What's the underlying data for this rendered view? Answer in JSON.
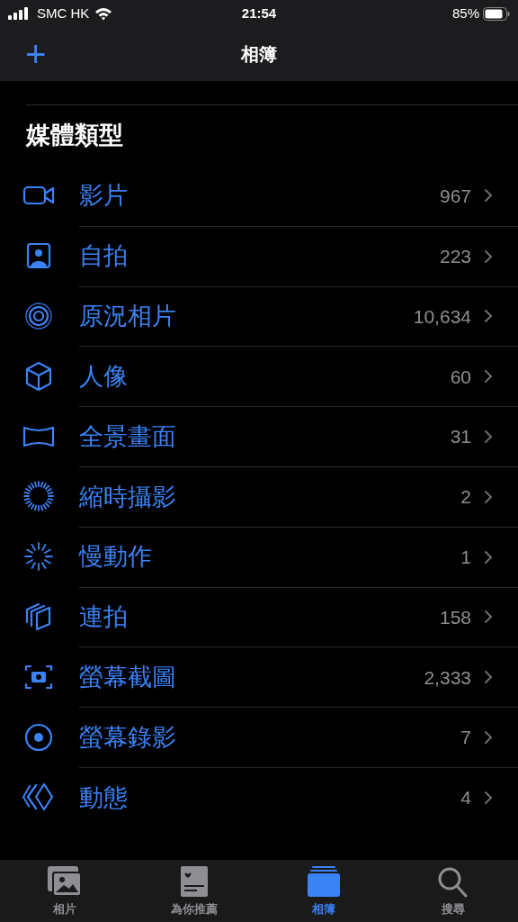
{
  "status_bar": {
    "carrier": "SMC HK",
    "time": "21:54",
    "battery": "85%"
  },
  "nav": {
    "add": "+",
    "title": "相簿"
  },
  "section": {
    "title": "媒體類型"
  },
  "rows": [
    {
      "kind": "video",
      "label": "影片",
      "count": "967"
    },
    {
      "kind": "selfie",
      "label": "自拍",
      "count": "223"
    },
    {
      "kind": "live",
      "label": "原況相片",
      "count": "10,634"
    },
    {
      "kind": "portrait",
      "label": "人像",
      "count": "60"
    },
    {
      "kind": "panorama",
      "label": "全景畫面",
      "count": "31"
    },
    {
      "kind": "timelapse",
      "label": "縮時攝影",
      "count": "2"
    },
    {
      "kind": "slomo",
      "label": "慢動作",
      "count": "1"
    },
    {
      "kind": "burst",
      "label": "連拍",
      "count": "158"
    },
    {
      "kind": "screenshot",
      "label": "螢幕截圖",
      "count": "2,333"
    },
    {
      "kind": "recording",
      "label": "螢幕錄影",
      "count": "7"
    },
    {
      "kind": "animated",
      "label": "動態",
      "count": "4"
    }
  ],
  "tabs": [
    {
      "kind": "photos",
      "label": "相片",
      "selected": false
    },
    {
      "kind": "foryou",
      "label": "為你推薦",
      "selected": false
    },
    {
      "kind": "albums",
      "label": "相簿",
      "selected": true
    },
    {
      "kind": "search",
      "label": "搜尋",
      "selected": false
    }
  ]
}
